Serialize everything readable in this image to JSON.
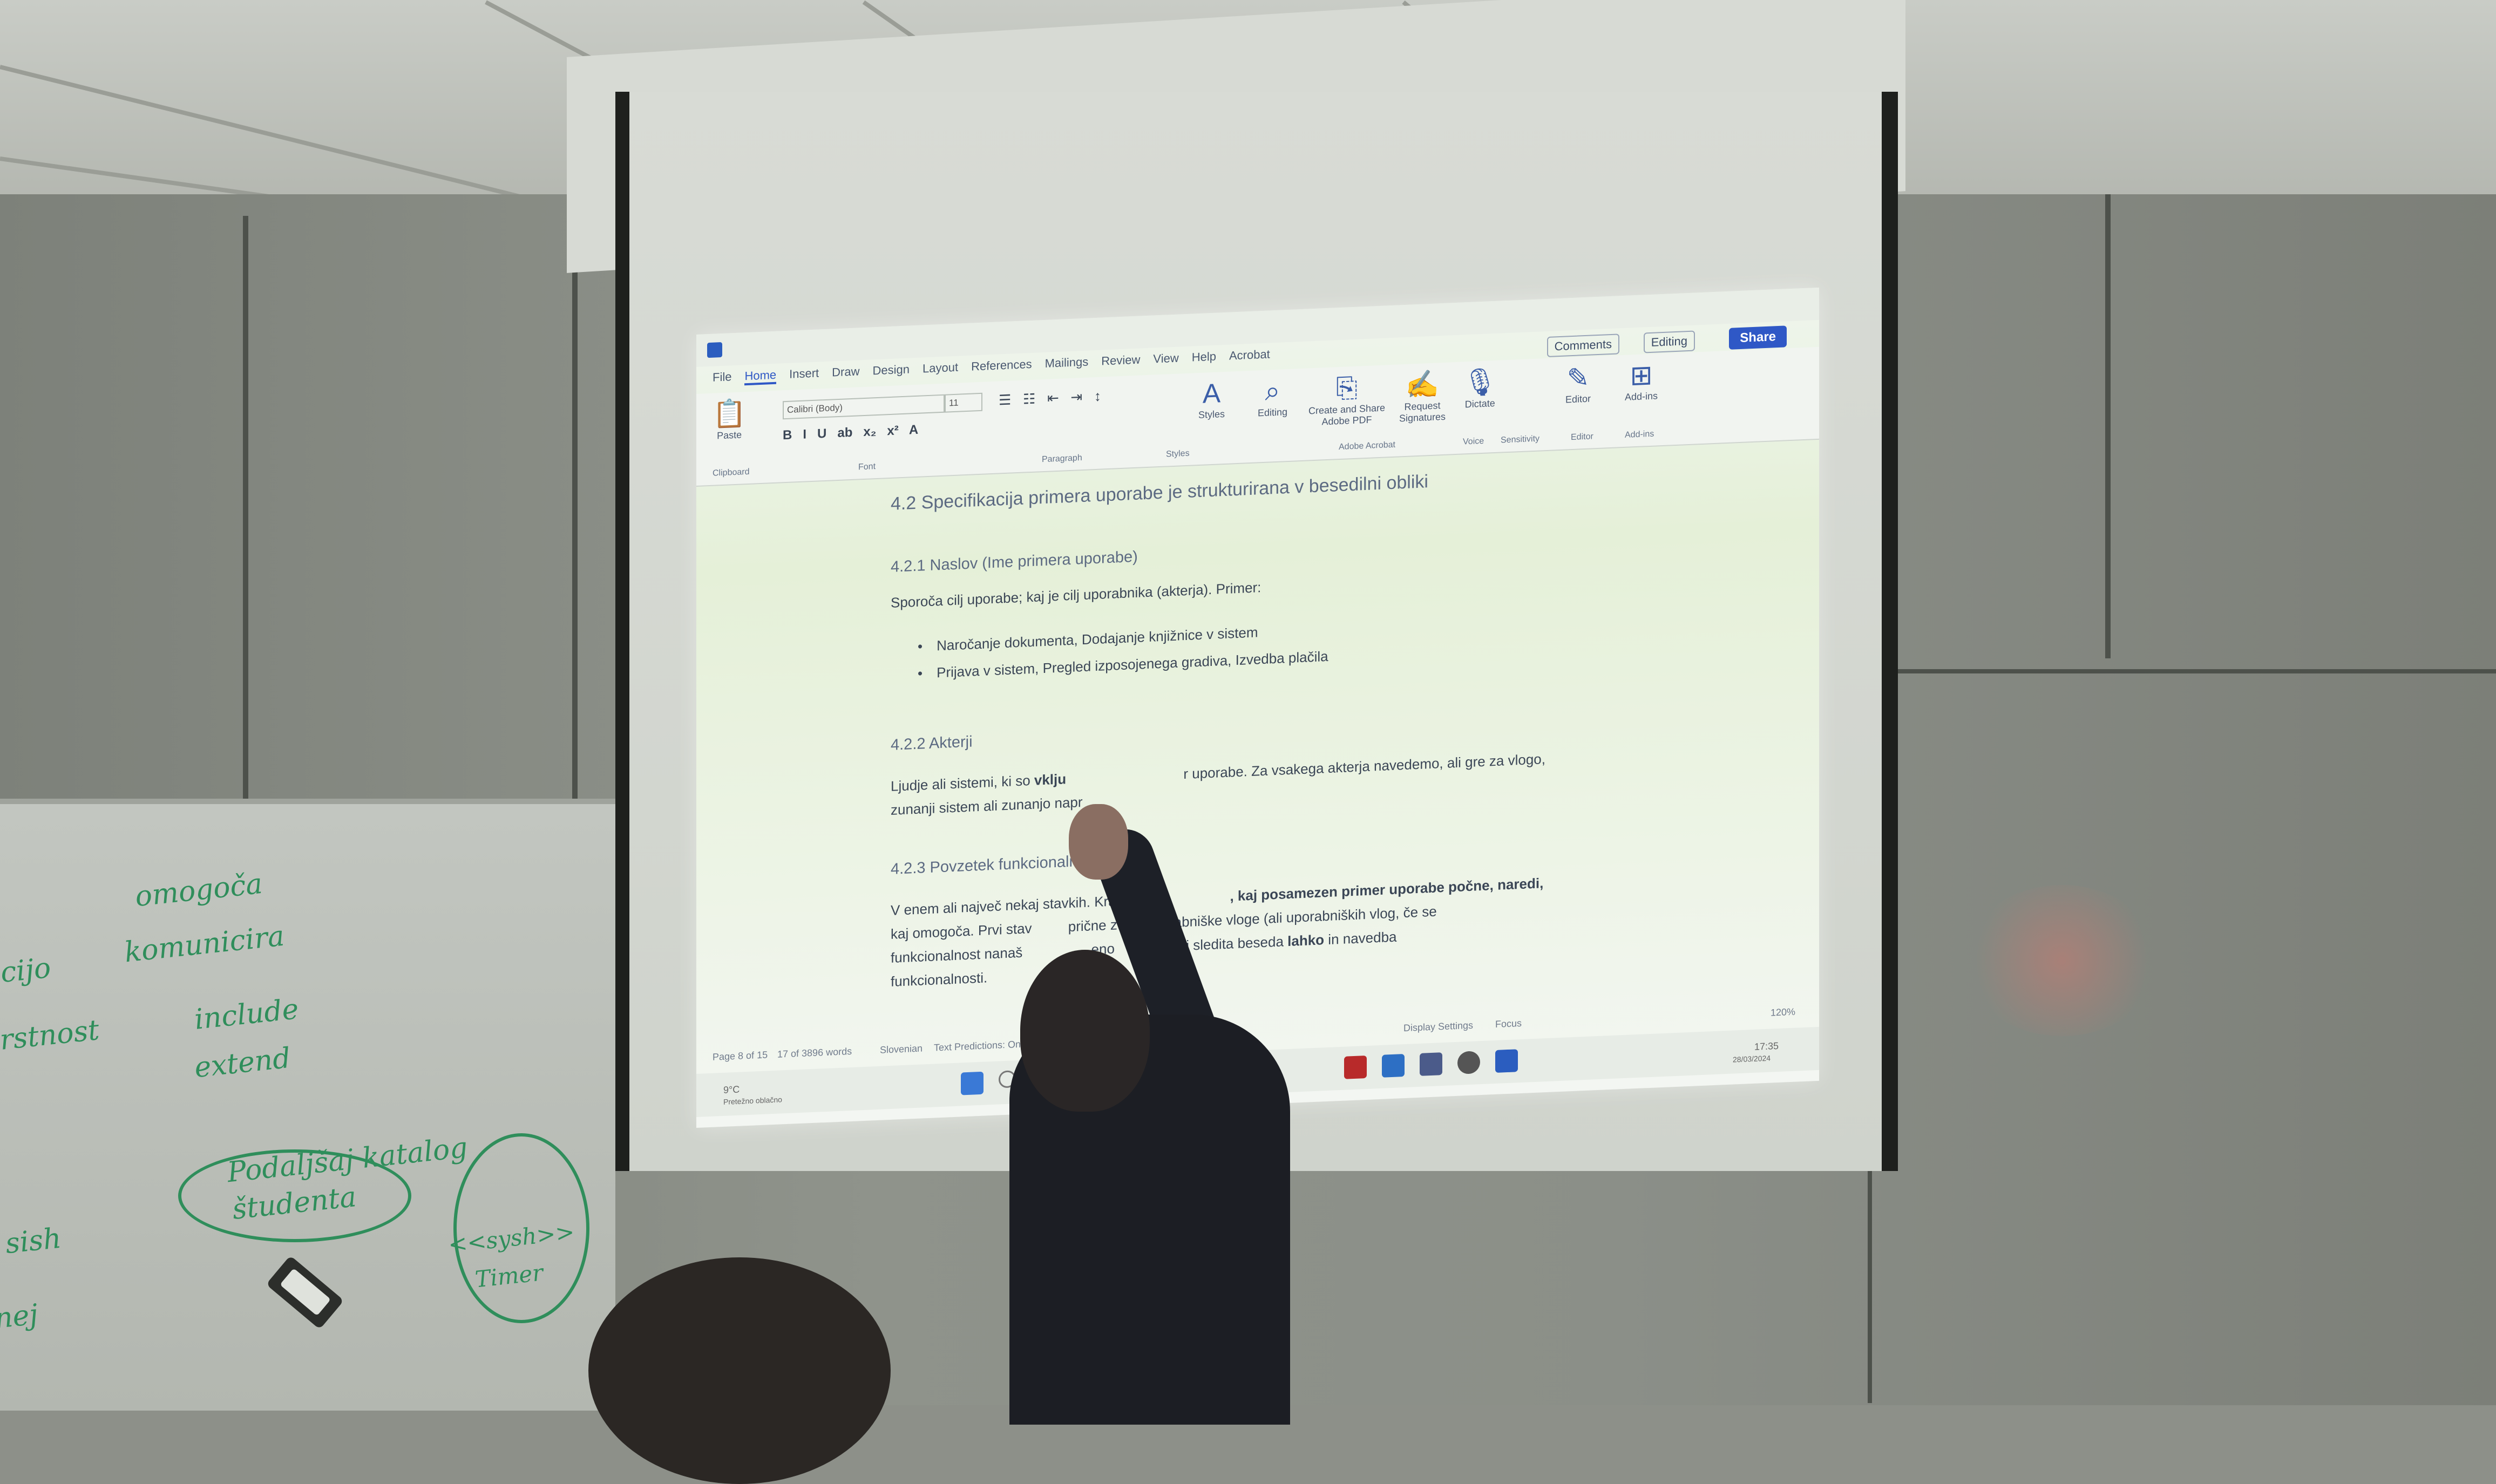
{
  "word": {
    "title_bar": {
      "share": "Share",
      "editing": "Editing",
      "comments": "Comments"
    },
    "tabs": [
      "File",
      "Home",
      "Insert",
      "Draw",
      "Design",
      "Layout",
      "References",
      "Mailings",
      "Review",
      "View",
      "Help",
      "Acrobat"
    ],
    "active_tab": "Home",
    "ribbon": {
      "font_name": "Calibri (Body)",
      "font_size": "11",
      "paste": "Paste",
      "clipboard": "Clipboard",
      "font": "Font",
      "paragraph": "Paragraph",
      "styles": "Styles",
      "styles_group": "Styles",
      "editing": "Editing",
      "create_share": "Create and Share Adobe PDF",
      "request_sig": "Request Signatures",
      "adobe_acrobat": "Adobe Acrobat",
      "dictate": "Dictate",
      "voice": "Voice",
      "sensitivity": "Sensitivity",
      "editor": "Editor",
      "editor_group": "Editor",
      "addins": "Add-ins",
      "addins_group": "Add-ins"
    },
    "document": {
      "h1": "4.2 Specifikacija primera uporabe je strukturirana v besedilni obliki",
      "h2a": "4.2.1 Naslov (Ime primera uporabe)",
      "p1": "Sporoča cilj uporabe; kaj je cilj uporabnika (akterja). Primer:",
      "bullets": [
        "Naročanje dokumenta, Dodajanje knjižnice v sistem",
        "Prijava v sistem, Pregled izposojenega gradiva, Izvedba plačila"
      ],
      "h2b": "4.2.2 Akterji",
      "p2a": "Ljudje ali sistemi, ki so",
      "p2bold": "vklju",
      "p2b": "r uporabe. Za vsakega akterja navedemo, ali gre za vlogo,",
      "p2c": "zunanji sistem ali zunanjo napr",
      "h2c": "4.2.3 Povzetek funkcionalnosti",
      "p3a": "V enem ali največ nekaj stavkih. Kratek te",
      "p3b": ", kaj posamezen primer uporabe počne, naredi,",
      "p3c": "kaj omogoča. Prvi stav",
      "p3d": "prične z",
      "p3e": "porabniške vloge (ali uporabniških vlog, če se",
      "p3f": "funkcionalnost nanaš",
      "p3g": "eno",
      "p3h": "pa naj sledita beseda",
      "p3bold": "lahko",
      "p3i": "in navedba",
      "p3j": "funkcionalnosti."
    },
    "status": {
      "page": "Page 8 of 15",
      "words": "17 of 3896 words",
      "language": "Slovenian",
      "predictions": "Text Predictions: On",
      "display": "Display Settings",
      "focus": "Focus",
      "zoom": "120%"
    },
    "taskbar": {
      "weather_temp": "9°C",
      "weather_desc": "Pretežno oblačno",
      "time": "17:35",
      "date": "28/03/2024"
    }
  },
  "whiteboard": {
    "words": [
      "omogoča",
      "komunicira",
      "include",
      "extend",
      "Podaljšaj katalog",
      "študenta",
      "<<sysh>>",
      "Timer",
      "acijo",
      "vrstnost",
      "sish",
      "nej"
    ]
  }
}
